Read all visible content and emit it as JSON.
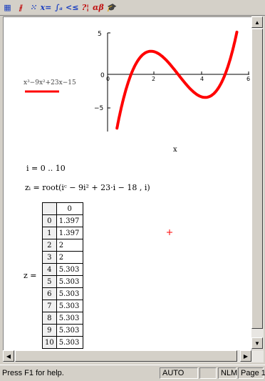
{
  "toolbar": {
    "buttons": [
      {
        "name": "calculator-palette-button",
        "glyph": "▦",
        "color": "blue"
      },
      {
        "name": "graph-palette-button",
        "glyph": "⫲",
        "color": "red"
      },
      {
        "name": "matrix-palette-button",
        "glyph": "⁙",
        "color": "blue"
      },
      {
        "name": "evaluation-palette-button",
        "glyph": "x=",
        "color": "blue"
      },
      {
        "name": "calculus-palette-button",
        "glyph": "∫ₐ",
        "color": "blue"
      },
      {
        "name": "boolean-palette-button",
        "glyph": "<≤",
        "color": "blue"
      },
      {
        "name": "programming-palette-button",
        "glyph": "?¦",
        "color": "red"
      },
      {
        "name": "greek-palette-button",
        "glyph": "αβ",
        "color": "red"
      },
      {
        "name": "symbolic-palette-button",
        "glyph": "🎓",
        "color": "blue"
      }
    ]
  },
  "worksheet": {
    "function_expr": "x³−9x²+23x−15",
    "x_axis_label": "x",
    "range_def": "i = 0 .. 10",
    "root_def": "zᵢ = root(iᶜ − 9i² + 23·i − 18 , i)",
    "table_var": "z =",
    "table_header": "0",
    "table_rows": [
      {
        "i": "0",
        "v": "1.397"
      },
      {
        "i": "1",
        "v": "1.397"
      },
      {
        "i": "2",
        "v": "2"
      },
      {
        "i": "3",
        "v": "2"
      },
      {
        "i": "4",
        "v": "5.303"
      },
      {
        "i": "5",
        "v": "5.303"
      },
      {
        "i": "6",
        "v": "5.303"
      },
      {
        "i": "7",
        "v": "5.303"
      },
      {
        "i": "8",
        "v": "5.303"
      },
      {
        "i": "9",
        "v": "5.303"
      },
      {
        "i": "10",
        "v": "5.303"
      }
    ]
  },
  "plot": {
    "y_ticks": [
      "5",
      "0",
      "−5"
    ],
    "x_ticks": [
      "0",
      "2",
      "4",
      "6"
    ],
    "x_range": [
      0,
      6
    ],
    "y_range": [
      -9,
      7
    ],
    "curve_color": "#ff0000"
  },
  "status": {
    "help": "Press F1 for help.",
    "mode": "AUTO",
    "nlm": "NLM",
    "page": "Page 1"
  }
}
